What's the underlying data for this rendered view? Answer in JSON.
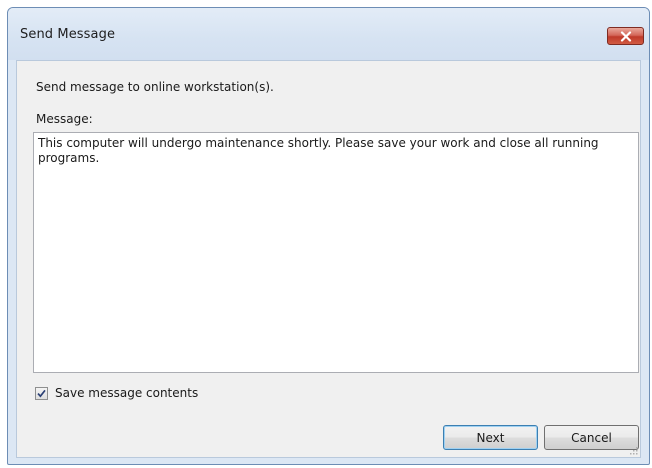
{
  "window": {
    "title": "Send Message",
    "close_icon": "close-icon"
  },
  "dialog": {
    "intro_text": "Send message to online workstation(s).",
    "message_label": "Message:",
    "message_value": "This computer will undergo maintenance shortly. Please save your work and close all running programs.",
    "save_checkbox": {
      "label": "Save message contents",
      "checked": true
    },
    "buttons": {
      "next_label": "Next",
      "cancel_label": "Cancel"
    }
  },
  "colors": {
    "titlebar": "#d6e3f2",
    "close_button": "#c9473a",
    "client_background": "#f0f0f0",
    "default_button_border": "#3c7fb1"
  }
}
